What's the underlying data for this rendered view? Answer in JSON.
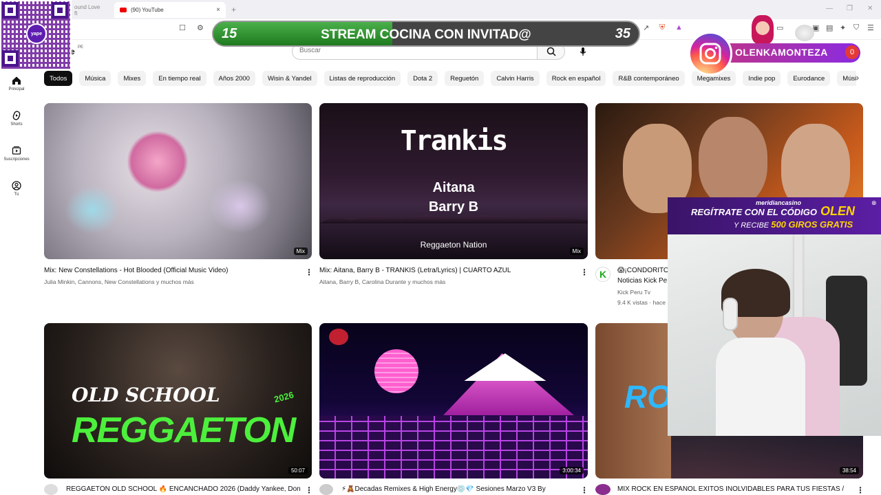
{
  "browser": {
    "tab_prev_label": "ound Love ft",
    "tab_active_label": "(90) YouTube",
    "tab_close": "×",
    "new_tab": "+"
  },
  "header": {
    "logo_fragment": "e",
    "region": "PE",
    "search_placeholder": "Buscar"
  },
  "sidebar": {
    "items": [
      {
        "label": "Principal",
        "icon": "home-icon"
      },
      {
        "label": "Shorts",
        "icon": "shorts-icon"
      },
      {
        "label": "Suscripciones",
        "icon": "subscriptions-icon"
      },
      {
        "label": "Tú",
        "icon": "you-icon"
      }
    ]
  },
  "chips": [
    "Todos",
    "Música",
    "Mixes",
    "En tiempo real",
    "Años 2000",
    "Wisin & Yandel",
    "Listas de reproducción",
    "Dota 2",
    "Reguetón",
    "Calvin Harris",
    "Rock en español",
    "R&B contemporáneo",
    "Megamixes",
    "Indie pop",
    "Eurodance",
    "Música car"
  ],
  "videos": [
    {
      "title": "Mix: New Constellations - Hot Blooded (Official Music Video)",
      "sub": "Julia Minkin, Cannons, New Constellations y muchos más",
      "badge": "Mix"
    },
    {
      "title": "Mix: Aitana, Barry B - TRANKIS (Letra/Lyrics) | CUARTO AZUL",
      "sub": "Aitana, Barry B, Carolina Durante y muchos más",
      "badge": "Mix",
      "thumb_title": "Trankis",
      "thumb_artist1": "Aitana",
      "thumb_artist2": "Barry B",
      "thumb_channel": "Reggaeton Nation"
    },
    {
      "title": "😱¡CONDORITO",
      "sub": "Noticias Kick Pe",
      "channel": "Kick Peru Tv",
      "meta": "9.4 K vistas · hace",
      "avatar_letter": "K"
    },
    {
      "title": "REGGAETÓN OLD SCHOOL 🔥 ENCANCHADO 2026 (Daddy Yankee, Don",
      "badge": "50:07",
      "thumb_line1": "OLD SCHOOL",
      "thumb_line2": "REGGAETON",
      "thumb_year": "2026"
    },
    {
      "title": "⚡🧸Decadas Remixes & High Energy💿💎 Sesiones Marzo V3 By",
      "badge": "3:00:34"
    },
    {
      "title": "MIX ROCK EN ESPAÑOL EXITOS INOLVIDABLES PARA TUS FIESTAS /",
      "badge": "38:54",
      "thumb_text": "RO"
    }
  ],
  "overlays": {
    "qr_logo": "yape",
    "stream_left": "15",
    "stream_title": "STREAM COCINA CON INVITAD@",
    "stream_right": "35",
    "stream_progress": 0.42,
    "instagram_name": "OLENKAMONTEZA",
    "instagram_count": "0",
    "casino_brand": "meridiancasino",
    "casino_line1": "REGÍTRATE CON EL CÓDIGO",
    "casino_code": "OLEN",
    "casino_line2_prefix": "Y RECIBE",
    "casino_line2_highlight": "500 GIROS GRATIS"
  },
  "colors": {
    "chip_active": "#0f0f0f",
    "chip_bg": "#f2f2f2",
    "stream_green": "#2e9a2e",
    "instagram_gradient": "#c13584",
    "casino_purple": "#4b1a8a",
    "casino_gold": "#ffd400"
  }
}
